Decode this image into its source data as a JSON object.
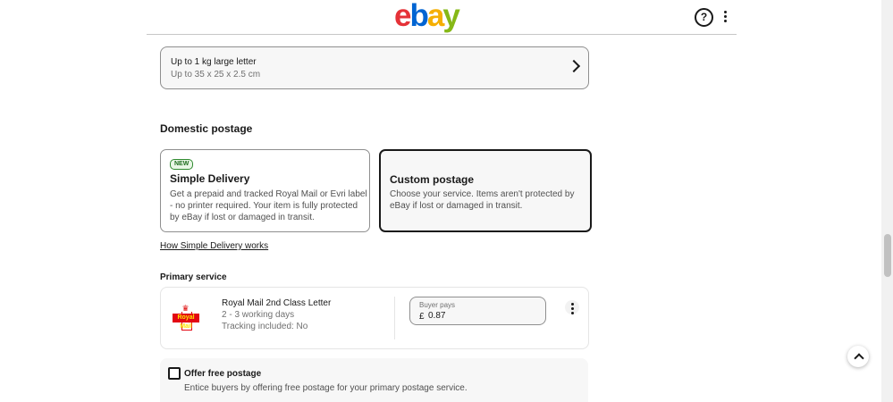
{
  "header": {
    "logo_letters": [
      "e",
      "b",
      "a",
      "y"
    ],
    "logo_colors": [
      "#e53238",
      "#0064d2",
      "#f5af02",
      "#86b817"
    ],
    "help_symbol": "?",
    "help_icon": "question-circle-icon",
    "more_icon": "vertical-dots-icon"
  },
  "size_option": {
    "title": "Up to 1 kg large letter",
    "subtitle": "Up to 35 x 25 x 2.5 cm",
    "icon": "chevron-right-icon"
  },
  "domestic_postage": {
    "title": "Domestic postage",
    "options": [
      {
        "badge": "NEW",
        "title": "Simple Delivery",
        "desc_lines": [
          "Get a prepaid and tracked Royal Mail or Evri label",
          "- no printer required. Your item is fully protected",
          "by eBay if lost or damaged in transit."
        ]
      },
      {
        "title": "Custom postage",
        "desc_lines": [
          "Choose your service. Items aren't protected by",
          "eBay if lost or damaged in transit."
        ]
      }
    ],
    "how_link": "How Simple Delivery works"
  },
  "primary_service": {
    "title": "Primary service",
    "carrier_logo_text": "Royal Mail",
    "name": "Royal Mail 2nd Class Letter",
    "days": "2 - 3 working days",
    "tracking": "Tracking included: No",
    "buyer_pays_label": "Buyer pays",
    "currency": "£",
    "price": "0.87",
    "more_icon": "vertical-dots-icon"
  },
  "free_postage": {
    "title": "Offer free postage",
    "desc": "Entice buyers by offering free postage for your primary postage service.",
    "checked": false
  },
  "scroll_top_icon": "chevron-up-icon",
  "colors": {
    "text": "#191919",
    "secondary_text": "#707070",
    "border": "#8f8f8f",
    "selected_bg": "#f7f7f7",
    "new_badge": "#2f8a2f",
    "royal_mail_red": "#e30613"
  }
}
